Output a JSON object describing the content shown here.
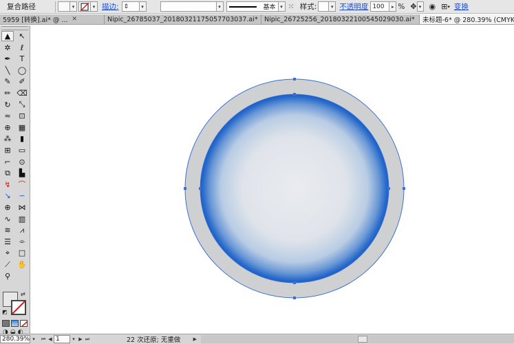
{
  "control_bar": {
    "object_type": "复合路径",
    "stroke_label": "描边:",
    "stroke_profile": "基本",
    "style_label": "样式:",
    "opacity_label": "不透明度",
    "opacity_value": "100",
    "opacity_unit": "%",
    "transform_label": "变换"
  },
  "tabs": [
    {
      "label": "5959 [转换].ai* @ ...",
      "active": false
    },
    {
      "label": "Nipic_26785037_20180321175057703037.ai*",
      "active": false
    },
    {
      "label": "Nipic_26725256_20180322100545029030.ai*",
      "active": false
    },
    {
      "label": "未标题-6* @ 280.39% (CMYK",
      "active": true
    }
  ],
  "tools": [
    {
      "icon": "selection-tool-icon",
      "glyph": "▲"
    },
    {
      "icon": "direct-selection-tool-icon",
      "glyph": "↖"
    },
    {
      "icon": "magic-wand-icon",
      "glyph": "✲"
    },
    {
      "icon": "lasso-icon",
      "glyph": "ℓ"
    },
    {
      "icon": "pen-tool-icon",
      "glyph": "✒"
    },
    {
      "icon": "type-tool-icon",
      "glyph": "T"
    },
    {
      "icon": "line-tool-icon",
      "glyph": "╲"
    },
    {
      "icon": "ellipse-tool-icon",
      "glyph": "◯"
    },
    {
      "icon": "paintbrush-icon",
      "glyph": "✎"
    },
    {
      "icon": "pencil-icon",
      "glyph": "✐"
    },
    {
      "icon": "blob-brush-icon",
      "glyph": "✏"
    },
    {
      "icon": "eraser-icon",
      "glyph": "⌫"
    },
    {
      "icon": "rotate-tool-icon",
      "glyph": "↻"
    },
    {
      "icon": "scale-tool-icon",
      "glyph": "⤡"
    },
    {
      "icon": "warp-tool-icon",
      "glyph": "≈"
    },
    {
      "icon": "free-transform-icon",
      "glyph": "⊡"
    },
    {
      "icon": "shape-builder-icon",
      "glyph": "⊕"
    },
    {
      "icon": "perspective-grid-icon",
      "glyph": "▦"
    },
    {
      "icon": "symbol-sprayer-icon",
      "glyph": "⁂"
    },
    {
      "icon": "column-graph-icon",
      "glyph": "▮"
    },
    {
      "icon": "mesh-tool-icon",
      "glyph": "⊞"
    },
    {
      "icon": "gradient-tool-icon",
      "glyph": "▭"
    },
    {
      "icon": "eyedropper-icon",
      "glyph": "⌐"
    },
    {
      "icon": "blend-tool-icon",
      "glyph": "⊙"
    },
    {
      "icon": "slice-tool-icon",
      "glyph": "⧉"
    },
    {
      "icon": "graph-tool-icon",
      "glyph": "▙"
    },
    {
      "icon": "anchor-add-icon",
      "glyph": "↯"
    },
    {
      "icon": "convert-anchor-icon",
      "glyph": "⌒"
    },
    {
      "icon": "anchor-delete-icon",
      "glyph": "↘"
    },
    {
      "icon": "curvature-icon",
      "glyph": "∽"
    },
    {
      "icon": "crosshair-icon",
      "glyph": "⊕"
    },
    {
      "icon": "envelope-distort-icon",
      "glyph": "⋈"
    },
    {
      "icon": "wave-distort-icon",
      "glyph": "∿"
    },
    {
      "icon": "bar-graph-icon",
      "glyph": "▥"
    },
    {
      "icon": "layers-stack-icon",
      "glyph": "≋"
    },
    {
      "icon": "zigzag-icon",
      "glyph": "⩘"
    },
    {
      "icon": "list-icon",
      "glyph": "☰"
    },
    {
      "icon": "eyedropper-alt-icon",
      "glyph": "⌯"
    },
    {
      "icon": "measure-icon",
      "glyph": "⌖"
    },
    {
      "icon": "artboard-icon",
      "glyph": "□"
    },
    {
      "icon": "knife-icon",
      "glyph": "⟋"
    },
    {
      "icon": "hand-tool-icon",
      "glyph": "✋"
    },
    {
      "icon": "zoom-tool-icon",
      "glyph": "⚲"
    }
  ],
  "status_bar": {
    "zoom": "280.39%",
    "artboard": "1",
    "undo_text": "22 次还原; 无重做"
  },
  "colors": {
    "ring_gray": "#cfd0d2",
    "rim_blue": "#1a5fc8",
    "center_light": "#e8eaee",
    "selection_blue": "#3b6fd6"
  }
}
